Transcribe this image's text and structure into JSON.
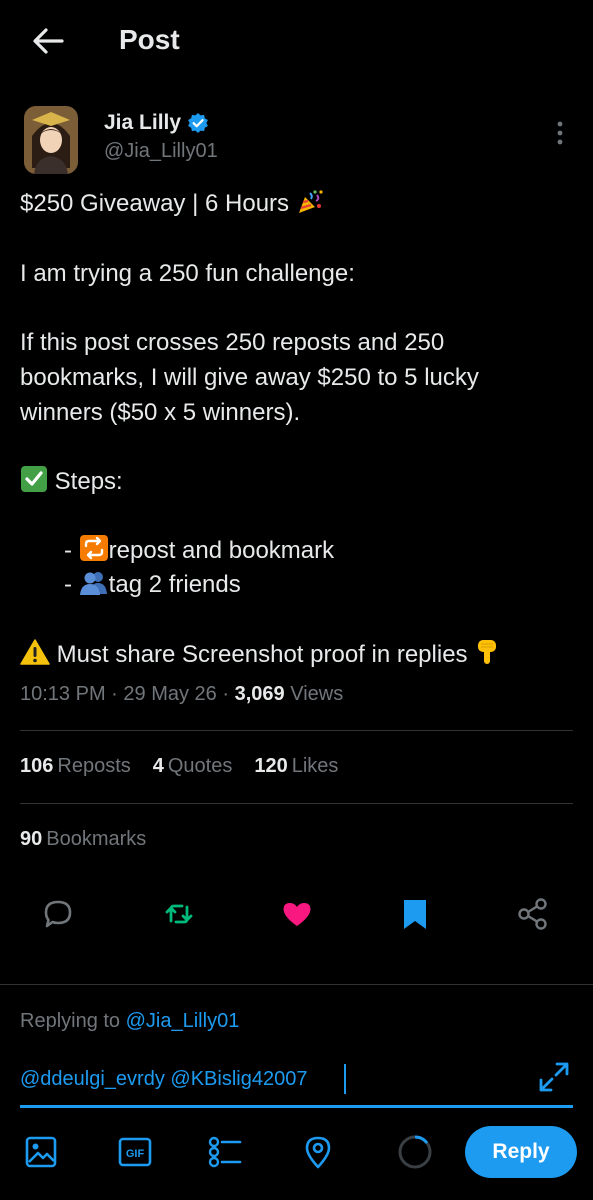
{
  "header": {
    "title": "Post"
  },
  "author": {
    "name": "Jia Lilly",
    "handle": "@Jia_Lilly01"
  },
  "post": {
    "line1": "$250 Giveaway | 6 Hours",
    "line2": "I am trying a 250 fun challenge:",
    "line3": "If this post crosses 250 reposts and 250",
    "line4": "bookmarks, I will give away $250 to 5 lucky",
    "line5": "winners ($50 x 5 winners).",
    "steps_label": "Steps:",
    "step1": "repost and bookmark",
    "step2": "tag 2 friends",
    "step_dash": "-",
    "warning": "Must share Screenshot proof in replies"
  },
  "meta": {
    "time": "10:13 PM",
    "sep": "·",
    "date": "29 May 26",
    "views_count": "3,069",
    "views_label": "Views"
  },
  "stats": {
    "reposts_count": "106",
    "reposts_label": "Reposts",
    "quotes_count": "4",
    "quotes_label": "Quotes",
    "likes_count": "120",
    "likes_label": "Likes",
    "bookmarks_count": "90",
    "bookmarks_label": "Bookmarks"
  },
  "reply": {
    "replying_prefix": "Replying to",
    "replying_handle": "@Jia_Lilly01",
    "input_value": "@ddeulgi_evrdy @KBislig42007",
    "button_label": "Reply",
    "gif_label": "GIF"
  },
  "colors": {
    "accent": "#1d9bf0",
    "repost": "#00ba7c",
    "like": "#f91880",
    "muted": "#71767b",
    "text": "#e7e9ea"
  },
  "icons": [
    "back-arrow-icon",
    "verified-badge-icon",
    "more-vertical-icon",
    "comment-icon",
    "repost-icon",
    "like-heart-icon",
    "bookmark-icon",
    "share-icon",
    "expand-icon",
    "image-icon",
    "gif-icon",
    "poll-icon",
    "location-icon",
    "progress-ring-icon"
  ]
}
